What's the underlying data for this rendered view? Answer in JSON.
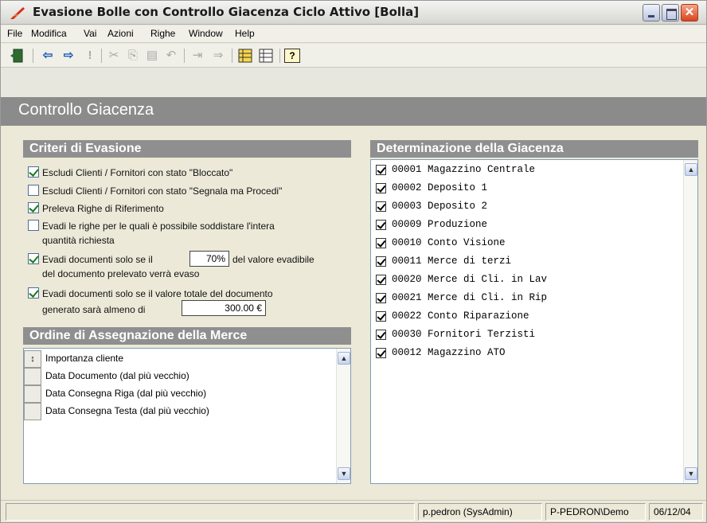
{
  "window": {
    "title": "Evasione Bolle con Controllo Giacenza Ciclo Attivo [Bolla]",
    "close_glyph": "✕"
  },
  "menu": [
    "File",
    "Modifica",
    "Vai",
    "Azioni",
    "Righe",
    "Window",
    "Help"
  ],
  "toolbar": {
    "icons": [
      "exit-door-icon",
      "back-arrow-icon",
      "forward-arrow-icon",
      "exclamation-icon",
      "cut-icon",
      "copy-icon",
      "paste-icon",
      "undo-icon",
      "insert-row-icon",
      "append-row-icon",
      "list-highlight-icon",
      "list-grid-icon",
      "help-icon"
    ],
    "glyphs": {
      "back": "⇦",
      "forward": "⇨",
      "exclamation": "!",
      "cut": "✂",
      "copy": "⎘",
      "paste": "▤",
      "undo": "↶",
      "insert": "⇥",
      "append": "⇒",
      "help": "?"
    }
  },
  "page": {
    "title": "Controllo Giacenza"
  },
  "criteri": {
    "header": "Criteri di Evasione",
    "items": [
      {
        "checked": true,
        "lines": [
          "Escludi Clienti / Fornitori con stato \"Bloccato\""
        ]
      },
      {
        "checked": false,
        "lines": [
          "Escludi Clienti / Fornitori con stato \"Segnala ma Procedi\""
        ]
      },
      {
        "checked": true,
        "lines": [
          "Preleva Righe di Riferimento"
        ]
      },
      {
        "checked": false,
        "lines": [
          "Evadi le righe per le quali è possibile soddistare l'intera",
          "quantità richiesta"
        ]
      },
      {
        "checked": true,
        "lines": [
          "Evadi documenti solo se il",
          "del valore evadibile",
          "del documento prelevato verrà evaso"
        ],
        "value": "70%"
      },
      {
        "checked": true,
        "lines": [
          "Evadi documenti solo se il valore totale del documento",
          "generato sarà almeno di"
        ],
        "value": "300.00 €"
      }
    ]
  },
  "ordine": {
    "header": "Ordine di Assegnazione della Merce",
    "handle_glyph": "↕",
    "items": [
      "Importanza cliente",
      "Data Documento (dal più vecchio)",
      "Data Consegna Riga (dal più vecchio)",
      "Data Consegna Testa (dal più vecchio)"
    ]
  },
  "giacenza": {
    "header": "Determinazione della Giacenza",
    "items": [
      "00001 Magazzino Centrale",
      "00002 Deposito 1",
      "00003 Deposito 2",
      "00009 Produzione",
      "00010 Conto Visione",
      "00011 Merce di terzi",
      "00020 Merce di Cli. in Lav",
      "00021 Merce di Cli. in Rip",
      "00022 Conto Riparazione",
      "00030 Fornitori Terzisti",
      "00012 Magazzino ATO"
    ]
  },
  "scroll": {
    "up": "▲",
    "down": "▼"
  },
  "status": {
    "user": "p.pedron (SysAdmin)",
    "company": "P-PEDRON\\Demo",
    "date": "06/12/04"
  }
}
